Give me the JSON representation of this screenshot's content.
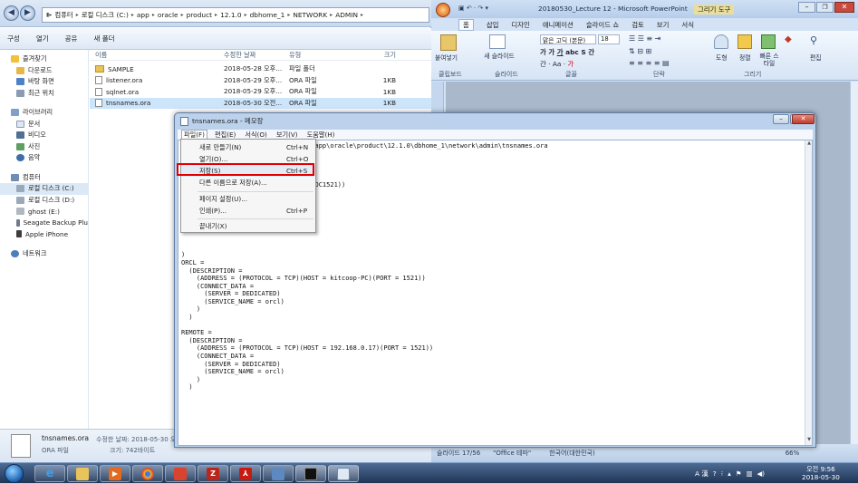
{
  "explorer": {
    "breadcrumb": [
      "컴퓨터",
      "로컬 디스크 (C:)",
      "app",
      "oracle",
      "product",
      "12.1.0",
      "dbhome_1",
      "NETWORK",
      "ADMIN"
    ],
    "toolbar": [
      "구성",
      "열기",
      "공유",
      "새 폴더"
    ],
    "nav": {
      "favorites": "즐겨찾기",
      "downloads": "다운로드",
      "desktop": "바탕 화면",
      "recent": "최근 위치",
      "libraries": "라이브러리",
      "documents": "문서",
      "videos": "비디오",
      "pictures": "사진",
      "music": "음악",
      "computer": "컴퓨터",
      "drive_c": "로컬 디스크 (C:)",
      "drive_d": "로컬 디스크 (D:)",
      "drive_e": "ghost (E:)",
      "seagate": "Seagate Backup Plu",
      "iphone": "Apple iPhone",
      "network": "네트워크"
    },
    "columns": {
      "name": "이름",
      "date": "수정한 날짜",
      "type": "유형",
      "size": "크기"
    },
    "files": [
      {
        "name": "SAMPLE",
        "date": "2018-05-28 오후...",
        "type": "파일 폴더",
        "size": ""
      },
      {
        "name": "listener.ora",
        "date": "2018-05-29 오후...",
        "type": "ORA 파일",
        "size": "1KB"
      },
      {
        "name": "sqlnet.ora",
        "date": "2018-05-29 오후...",
        "type": "ORA 파일",
        "size": "1KB"
      },
      {
        "name": "tnsnames.ora",
        "date": "2018-05-30 오전...",
        "type": "ORA 파일",
        "size": "1KB"
      }
    ],
    "details": {
      "filename": "tnsnames.ora",
      "modified_label": "수정한 날짜: 2018-05-30 오전",
      "filetype": "ORA 파일",
      "size_label": "크기: 742바이트"
    }
  },
  "ppt": {
    "title": "20180530_Lecture 12 - Microsoft PowerPoint",
    "context_tab": "그리기 도구",
    "tabs": [
      "홈",
      "삽입",
      "디자인",
      "애니메이션",
      "슬라이드 쇼",
      "검토",
      "보기",
      "서식"
    ],
    "groups": {
      "clipboard": "클립보드",
      "slides": "슬라이드",
      "font": "글꼴",
      "paragraph": "단락",
      "drawing": "그리기"
    },
    "buttons": {
      "paste": "붙여넣기",
      "new_slide": "새 슬라이드",
      "font_name": "맑은 고딕 (본문)",
      "font_size": "18",
      "shapes": "도형",
      "arrange": "정렬",
      "quick_styles": "빠른 스타일",
      "edit": "편집"
    },
    "status": {
      "slide": "슬라이드 17/56",
      "theme": "\"Office 테마\"",
      "lang": "한국어(대한민국)",
      "zoom": "66%"
    }
  },
  "notepad": {
    "title": "tnsnames.ora - 메모장",
    "menus": [
      "파일(F)",
      "편집(E)",
      "서식(O)",
      "보기(V)",
      "도움말(H)"
    ],
    "file_menu": [
      {
        "label": "새로 만들기(N)",
        "shortcut": "Ctrl+N"
      },
      {
        "label": "열기(O)...",
        "shortcut": "Ctrl+O"
      },
      {
        "label": "저장(S)",
        "shortcut": "Ctrl+S"
      },
      {
        "label": "다른 이름으로 저장(A)...",
        "shortcut": ""
      },
      {
        "label": "페이지 설정(U)...",
        "shortcut": ""
      },
      {
        "label": "인쇄(P)...",
        "shortcut": "Ctrl+P"
      },
      {
        "label": "끝내기(X)",
        "shortcut": ""
      }
    ],
    "content": "                          File: c:\\app\\oracle\\product\\12.1.0\\dbhome_1\\network\\admin\\tnsnames.ora\n                          tools.\n\n\n\n                          V = EXTPROC1521))\n\n\n\n\n\n\n\n\n)\nORCL =\n  (DESCRIPTION =\n    (ADDRESS = (PROTOCOL = TCP)(HOST = kitcoop-PC)(PORT = 1521))\n    (CONNECT_DATA =\n      (SERVER = DEDICATED)\n      (SERVICE_NAME = orcl)\n    )\n  )\n\nREMOTE =\n  (DESCRIPTION =\n    (ADDRESS = (PROTOCOL = TCP)(HOST = 192.168.0.17)(PORT = 1521))\n    (CONNECT_DATA =\n      (SERVER = DEDICATED)\n      (SERVICE_NAME = orcl)\n    )\n  )"
  },
  "taskbar": {
    "tray_lang": "A 漢",
    "clock_time": "오전 9:56",
    "clock_date": "2018-05-30"
  },
  "colors": {
    "highlight": "#e10000",
    "taskbar": "#1f3556",
    "selection": "#cde5fb"
  }
}
